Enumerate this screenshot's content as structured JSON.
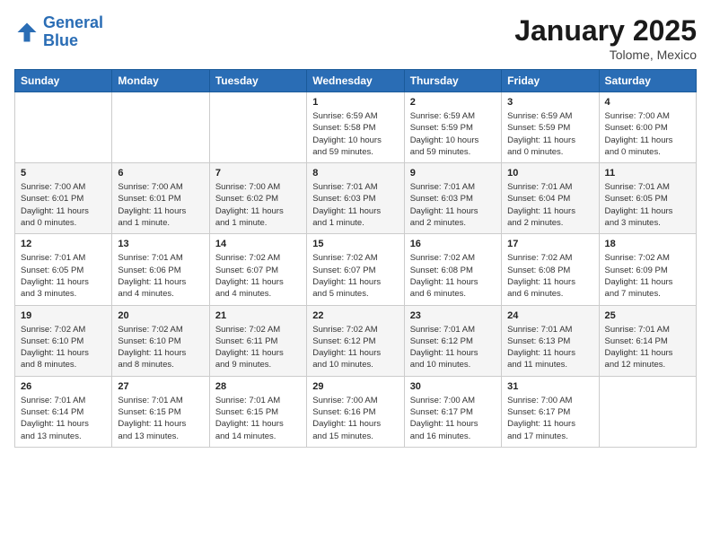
{
  "header": {
    "logo_line1": "General",
    "logo_line2": "Blue",
    "month": "January 2025",
    "location": "Tolome, Mexico"
  },
  "days_of_week": [
    "Sunday",
    "Monday",
    "Tuesday",
    "Wednesday",
    "Thursday",
    "Friday",
    "Saturday"
  ],
  "weeks": [
    [
      {
        "day": "",
        "info": ""
      },
      {
        "day": "",
        "info": ""
      },
      {
        "day": "",
        "info": ""
      },
      {
        "day": "1",
        "info": "Sunrise: 6:59 AM\nSunset: 5:58 PM\nDaylight: 10 hours\nand 59 minutes."
      },
      {
        "day": "2",
        "info": "Sunrise: 6:59 AM\nSunset: 5:59 PM\nDaylight: 10 hours\nand 59 minutes."
      },
      {
        "day": "3",
        "info": "Sunrise: 6:59 AM\nSunset: 5:59 PM\nDaylight: 11 hours\nand 0 minutes."
      },
      {
        "day": "4",
        "info": "Sunrise: 7:00 AM\nSunset: 6:00 PM\nDaylight: 11 hours\nand 0 minutes."
      }
    ],
    [
      {
        "day": "5",
        "info": "Sunrise: 7:00 AM\nSunset: 6:01 PM\nDaylight: 11 hours\nand 0 minutes."
      },
      {
        "day": "6",
        "info": "Sunrise: 7:00 AM\nSunset: 6:01 PM\nDaylight: 11 hours\nand 1 minute."
      },
      {
        "day": "7",
        "info": "Sunrise: 7:00 AM\nSunset: 6:02 PM\nDaylight: 11 hours\nand 1 minute."
      },
      {
        "day": "8",
        "info": "Sunrise: 7:01 AM\nSunset: 6:03 PM\nDaylight: 11 hours\nand 1 minute."
      },
      {
        "day": "9",
        "info": "Sunrise: 7:01 AM\nSunset: 6:03 PM\nDaylight: 11 hours\nand 2 minutes."
      },
      {
        "day": "10",
        "info": "Sunrise: 7:01 AM\nSunset: 6:04 PM\nDaylight: 11 hours\nand 2 minutes."
      },
      {
        "day": "11",
        "info": "Sunrise: 7:01 AM\nSunset: 6:05 PM\nDaylight: 11 hours\nand 3 minutes."
      }
    ],
    [
      {
        "day": "12",
        "info": "Sunrise: 7:01 AM\nSunset: 6:05 PM\nDaylight: 11 hours\nand 3 minutes."
      },
      {
        "day": "13",
        "info": "Sunrise: 7:01 AM\nSunset: 6:06 PM\nDaylight: 11 hours\nand 4 minutes."
      },
      {
        "day": "14",
        "info": "Sunrise: 7:02 AM\nSunset: 6:07 PM\nDaylight: 11 hours\nand 4 minutes."
      },
      {
        "day": "15",
        "info": "Sunrise: 7:02 AM\nSunset: 6:07 PM\nDaylight: 11 hours\nand 5 minutes."
      },
      {
        "day": "16",
        "info": "Sunrise: 7:02 AM\nSunset: 6:08 PM\nDaylight: 11 hours\nand 6 minutes."
      },
      {
        "day": "17",
        "info": "Sunrise: 7:02 AM\nSunset: 6:08 PM\nDaylight: 11 hours\nand 6 minutes."
      },
      {
        "day": "18",
        "info": "Sunrise: 7:02 AM\nSunset: 6:09 PM\nDaylight: 11 hours\nand 7 minutes."
      }
    ],
    [
      {
        "day": "19",
        "info": "Sunrise: 7:02 AM\nSunset: 6:10 PM\nDaylight: 11 hours\nand 8 minutes."
      },
      {
        "day": "20",
        "info": "Sunrise: 7:02 AM\nSunset: 6:10 PM\nDaylight: 11 hours\nand 8 minutes."
      },
      {
        "day": "21",
        "info": "Sunrise: 7:02 AM\nSunset: 6:11 PM\nDaylight: 11 hours\nand 9 minutes."
      },
      {
        "day": "22",
        "info": "Sunrise: 7:02 AM\nSunset: 6:12 PM\nDaylight: 11 hours\nand 10 minutes."
      },
      {
        "day": "23",
        "info": "Sunrise: 7:01 AM\nSunset: 6:12 PM\nDaylight: 11 hours\nand 10 minutes."
      },
      {
        "day": "24",
        "info": "Sunrise: 7:01 AM\nSunset: 6:13 PM\nDaylight: 11 hours\nand 11 minutes."
      },
      {
        "day": "25",
        "info": "Sunrise: 7:01 AM\nSunset: 6:14 PM\nDaylight: 11 hours\nand 12 minutes."
      }
    ],
    [
      {
        "day": "26",
        "info": "Sunrise: 7:01 AM\nSunset: 6:14 PM\nDaylight: 11 hours\nand 13 minutes."
      },
      {
        "day": "27",
        "info": "Sunrise: 7:01 AM\nSunset: 6:15 PM\nDaylight: 11 hours\nand 13 minutes."
      },
      {
        "day": "28",
        "info": "Sunrise: 7:01 AM\nSunset: 6:15 PM\nDaylight: 11 hours\nand 14 minutes."
      },
      {
        "day": "29",
        "info": "Sunrise: 7:00 AM\nSunset: 6:16 PM\nDaylight: 11 hours\nand 15 minutes."
      },
      {
        "day": "30",
        "info": "Sunrise: 7:00 AM\nSunset: 6:17 PM\nDaylight: 11 hours\nand 16 minutes."
      },
      {
        "day": "31",
        "info": "Sunrise: 7:00 AM\nSunset: 6:17 PM\nDaylight: 11 hours\nand 17 minutes."
      },
      {
        "day": "",
        "info": ""
      }
    ]
  ]
}
